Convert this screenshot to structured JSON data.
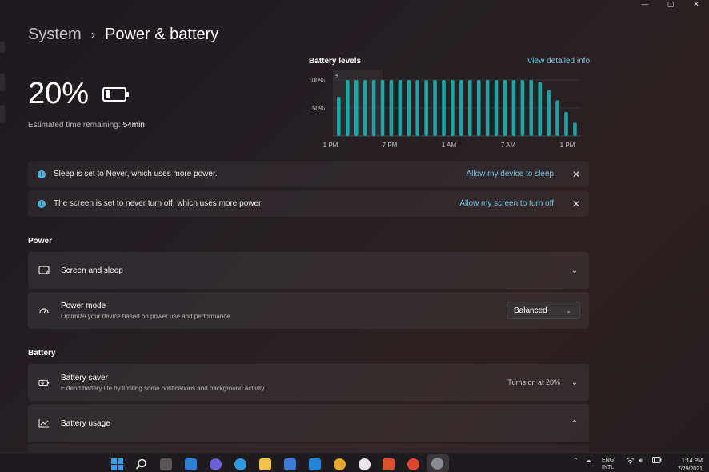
{
  "window": {
    "minimize": "—",
    "maximize": "▢",
    "close": "✕"
  },
  "header": {
    "crumb": "System",
    "title": "Power & battery"
  },
  "battery": {
    "percent": "20%",
    "level": 0.2,
    "estimated_label": "Estimated time remaining:",
    "estimated_value": "54min"
  },
  "chart_data": {
    "type": "bar",
    "title": "Battery levels",
    "link": "View detailed info",
    "y_ticks": [
      "100%",
      "50%"
    ],
    "x_labels": [
      "1 PM",
      "7 PM",
      "1 AM",
      "7 AM",
      "1 PM"
    ],
    "values": [
      70,
      100,
      100,
      100,
      100,
      100,
      100,
      100,
      100,
      100,
      100,
      100,
      100,
      100,
      100,
      100,
      100,
      100,
      100,
      100,
      100,
      100,
      100,
      96,
      82,
      64,
      43,
      24
    ],
    "ylim": [
      0,
      100
    ],
    "color": "#1aa6a6"
  },
  "banners": [
    {
      "message": "Sleep is set to Never, which uses more power.",
      "action": "Allow my device to sleep",
      "close": "✕"
    },
    {
      "message": "The screen is set to never turn off, which uses more power.",
      "action": "Allow my screen to turn off",
      "close": "✕"
    }
  ],
  "power": {
    "heading": "Power",
    "screen_sleep": {
      "label": "Screen and sleep"
    },
    "power_mode": {
      "label": "Power mode",
      "description": "Optimize your device based on power use and performance",
      "value": "Balanced"
    }
  },
  "battery_section": {
    "heading": "Battery",
    "saver": {
      "label": "Battery saver",
      "description": "Extend battery life by limiting some notifications and background activity",
      "status": "Turns on at 20%"
    },
    "usage": {
      "label": "Battery usage"
    }
  },
  "taskbar": {
    "language_line1": "ENG",
    "language_line2": "INTL",
    "time": "1:14 PM",
    "date": "7/29/2021",
    "colors": {
      "start": "#3a9be8",
      "edge": "#2e9be0",
      "explorer": "#f1c24b",
      "store": "#3d7ad8"
    }
  }
}
